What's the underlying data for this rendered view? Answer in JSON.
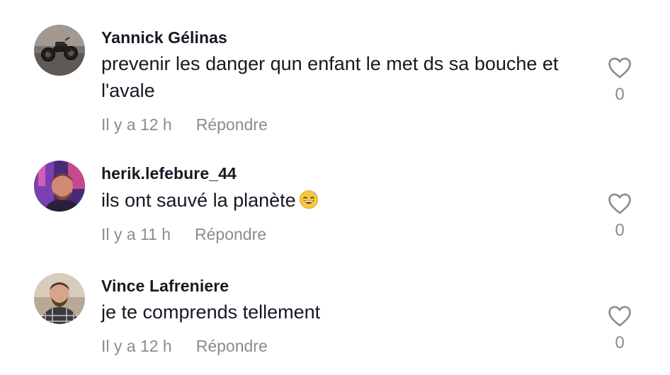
{
  "comments": [
    {
      "username": "Yannick Gélinas",
      "text": "prevenir les danger qun enfant le met ds sa bouche et l'avale",
      "time": "Il y a 12 h",
      "reply_label": "Répondre",
      "likes": "0",
      "avatar_icon": "avatar-motorcycle"
    },
    {
      "username": "herik.lefebure_44",
      "text": "ils ont sauvé la planète",
      "emoji": "😅",
      "time": "Il y a 11 h",
      "reply_label": "Répondre",
      "likes": "0",
      "avatar_icon": "avatar-man-purple-light"
    },
    {
      "username": "Vince Lafreniere",
      "text": "je te comprends tellement",
      "time": "Il y a 12 h",
      "reply_label": "Répondre",
      "likes": "0",
      "avatar_icon": "avatar-man-plaid-shirt"
    }
  ],
  "colors": {
    "text": "#161823",
    "secondary": "#8a8b91",
    "background": "#ffffff"
  }
}
